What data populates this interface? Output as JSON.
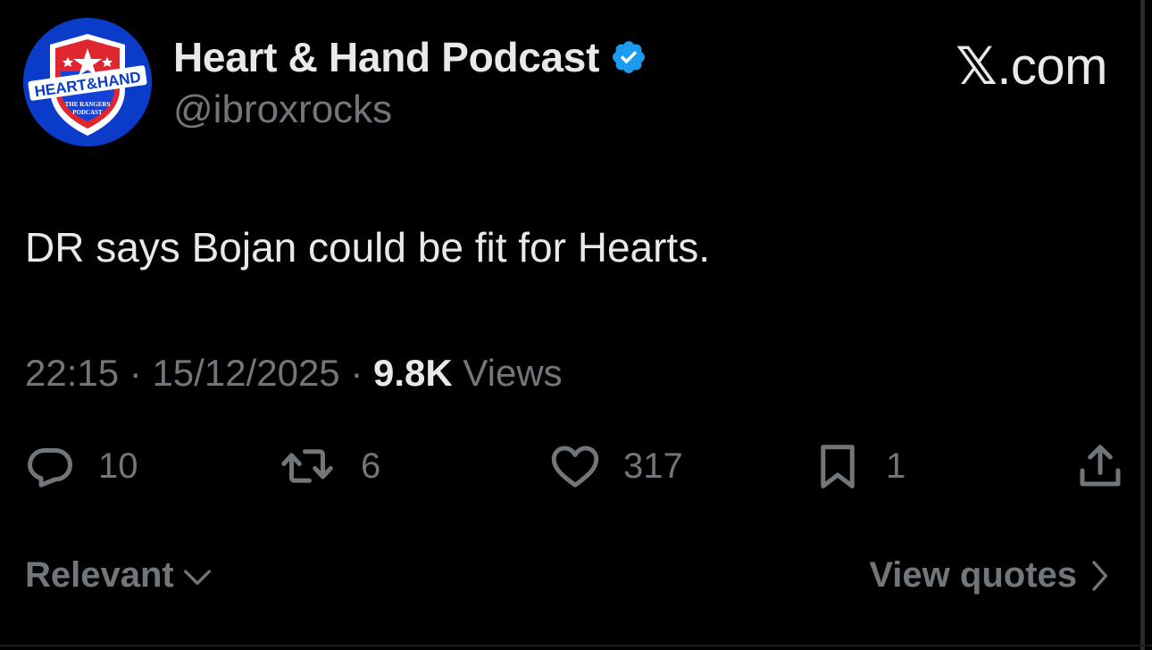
{
  "author": {
    "display_name": "Heart & Hand Podcast",
    "handle": "@ibroxrocks",
    "verified": true,
    "avatar": {
      "logo_text": "HEART&HAND",
      "sub_text_line1": "THE RANGERS",
      "sub_text_line2": "PODCAST"
    }
  },
  "brand": {
    "x_letter": "𝕏",
    "suffix": ".com"
  },
  "tweet": {
    "text": "DR says Bojan could be fit for Hearts.",
    "time": "22:15",
    "separator": "·",
    "date": "15/12/2025",
    "views_count": "9.8K",
    "views_label": "Views"
  },
  "actions": {
    "replies": "10",
    "reposts": "6",
    "likes": "317",
    "bookmarks": "1"
  },
  "footer": {
    "sort_label": "Relevant",
    "view_quotes_label": "View quotes"
  },
  "colors": {
    "background": "#000000",
    "primary_text": "#e7e9ea",
    "secondary_text": "#71767b",
    "verified_blue": "#1d9bf0",
    "avatar_blue": "#0b3bc9",
    "avatar_red": "#e0262e"
  },
  "icons": {
    "reply": "speech-bubble-icon",
    "repost": "repost-arrows-icon",
    "like": "heart-icon",
    "bookmark": "bookmark-icon",
    "share": "share-upload-icon",
    "verified": "verified-badge-icon",
    "sort": "chevron-down-icon",
    "quotes": "chevron-right-icon"
  }
}
